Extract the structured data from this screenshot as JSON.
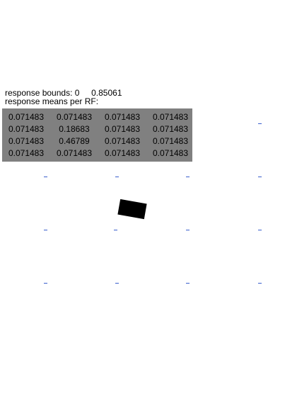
{
  "bounds": {
    "label": "response bounds:",
    "min": "0",
    "max": "0.85061"
  },
  "means_label": "response means per RF:",
  "means": [
    [
      "0.071483",
      "0.071483",
      "0.071483",
      "0.071483"
    ],
    [
      "0.071483",
      "0.18683",
      "0.071483",
      "0.071483"
    ],
    [
      "0.071483",
      "0.46789",
      "0.071483",
      "0.071483"
    ],
    [
      "0.071483",
      "0.071483",
      "0.071483",
      "0.071483"
    ]
  ],
  "colors": {
    "panel": "#808080",
    "tick": "#3a5fcd",
    "stimulus": "#000000"
  }
}
